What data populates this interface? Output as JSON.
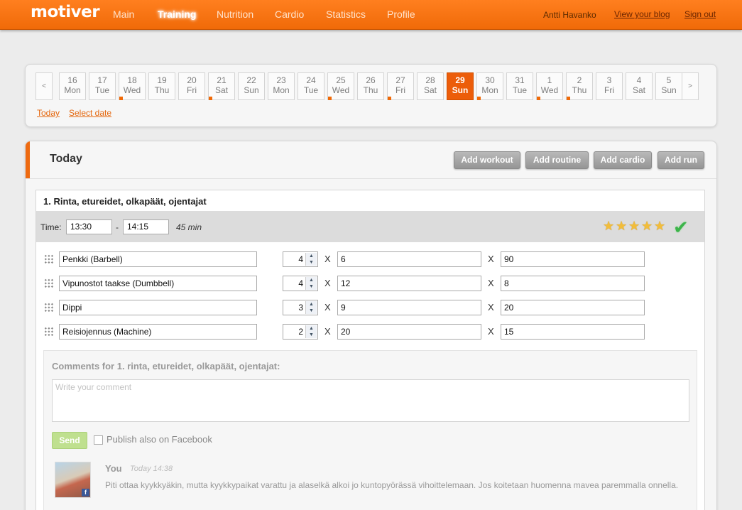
{
  "app": {
    "logo": "motiver"
  },
  "nav": {
    "items": [
      {
        "label": "Main"
      },
      {
        "label": "Training"
      },
      {
        "label": "Nutrition"
      },
      {
        "label": "Cardio"
      },
      {
        "label": "Statistics"
      },
      {
        "label": "Profile"
      }
    ],
    "active": "Training",
    "user_name": "Antti Havanko",
    "view_blog": "View your blog",
    "sign_out": "Sign out"
  },
  "calendar": {
    "prev": "<",
    "next": ">",
    "days": [
      {
        "num": "16",
        "name": "Mon",
        "marked": false,
        "selected": false
      },
      {
        "num": "17",
        "name": "Tue",
        "marked": false,
        "selected": false
      },
      {
        "num": "18",
        "name": "Wed",
        "marked": true,
        "selected": false
      },
      {
        "num": "19",
        "name": "Thu",
        "marked": false,
        "selected": false
      },
      {
        "num": "20",
        "name": "Fri",
        "marked": false,
        "selected": false
      },
      {
        "num": "21",
        "name": "Sat",
        "marked": true,
        "selected": false
      },
      {
        "num": "22",
        "name": "Sun",
        "marked": false,
        "selected": false
      },
      {
        "num": "23",
        "name": "Mon",
        "marked": false,
        "selected": false
      },
      {
        "num": "24",
        "name": "Tue",
        "marked": false,
        "selected": false
      },
      {
        "num": "25",
        "name": "Wed",
        "marked": true,
        "selected": false
      },
      {
        "num": "26",
        "name": "Thu",
        "marked": false,
        "selected": false
      },
      {
        "num": "27",
        "name": "Fri",
        "marked": true,
        "selected": false
      },
      {
        "num": "28",
        "name": "Sat",
        "marked": false,
        "selected": false
      },
      {
        "num": "29",
        "name": "Sun",
        "marked": false,
        "selected": true
      },
      {
        "num": "30",
        "name": "Mon",
        "marked": true,
        "selected": false
      },
      {
        "num": "31",
        "name": "Tue",
        "marked": false,
        "selected": false
      },
      {
        "num": "1",
        "name": "Wed",
        "marked": true,
        "selected": false
      },
      {
        "num": "2",
        "name": "Thu",
        "marked": true,
        "selected": false
      },
      {
        "num": "3",
        "name": "Fri",
        "marked": false,
        "selected": false
      },
      {
        "num": "4",
        "name": "Sat",
        "marked": false,
        "selected": false
      },
      {
        "num": "5",
        "name": "Sun",
        "marked": false,
        "selected": false
      }
    ],
    "today_link": "Today",
    "select_date_link": "Select date"
  },
  "day_panel": {
    "title": "Today",
    "buttons": {
      "add_workout": "Add workout",
      "add_routine": "Add routine",
      "add_cardio": "Add cardio",
      "add_run": "Add run"
    }
  },
  "workout": {
    "title": "1. Rinta, etureidet, olkapäät, ojentajat",
    "time_label": "Time:",
    "start": "13:30",
    "dash": "-",
    "end": "14:15",
    "duration": "45 min",
    "rating": 5,
    "exercises": [
      {
        "name": "Penkki (Barbell)",
        "sets": "4",
        "reps": "6",
        "weight": "90"
      },
      {
        "name": "Vipunostot taakse (Dumbbell)",
        "sets": "4",
        "reps": "12",
        "weight": "8"
      },
      {
        "name": "Dippi",
        "sets": "3",
        "reps": "9",
        "weight": "20"
      },
      {
        "name": "Reisiojennus (Machine)",
        "sets": "2",
        "reps": "20",
        "weight": "15"
      }
    ],
    "x_sep": "X"
  },
  "comments": {
    "title": "Comments for 1. rinta, etureidet, olkapäät, ojentajat:",
    "placeholder": "Write your comment",
    "send_label": "Send",
    "facebook_label": "Publish also on Facebook",
    "items": [
      {
        "author": "You",
        "time": "Today 14:38",
        "text": "Piti ottaa kyykkyäkin, mutta kyykkypaikat varattu ja alaselkä alkoi jo kuntopyörässä vihoittelemaan. Jos koitetaan huomenna mavea paremmalla onnella."
      }
    ]
  },
  "colors": {
    "brand_orange": "#f06a08",
    "selected_day": "#ec5d0a",
    "action_button": "#a6a6a6",
    "send_button": "#bfe08f",
    "check": "#3cb44a",
    "star": "#f2bd3a"
  }
}
